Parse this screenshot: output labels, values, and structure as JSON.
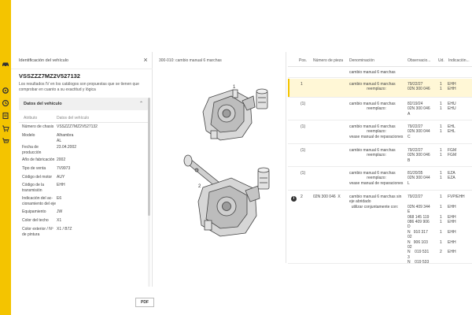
{
  "panel": {
    "title": "Identificación del vehículo",
    "vin": "VSSZZZ7MZ2V527132",
    "description": "Los resultados IV en los catálogos son propuestas que se tienen que comprobar en cuanto a su exactitud y lógica",
    "section_title": "Datos del vehículo",
    "attr_header": "Atributo",
    "value_header": "Datos del vehículo",
    "pdf_label": "PDF",
    "rows": [
      {
        "label": "Número de chasis",
        "value": "VSSZZZ7MZ2V527132"
      },
      {
        "label": "Modelo",
        "value": "Alhambra\nAL"
      },
      {
        "label": "Fecha de\nproducción",
        "value": "23.04.2002"
      },
      {
        "label": "Año de fabricación",
        "value": "2002"
      },
      {
        "label": "Tipo de venta",
        "value": "7V9973"
      },
      {
        "label": "Código del motor",
        "value": "AUY"
      },
      {
        "label": "Código de la\ntransmisión",
        "value": "EHH"
      },
      {
        "label": "Indicación del ac-\ncionamiento del eje",
        "value": "E6"
      },
      {
        "label": "Equipamiento",
        "value": "JW"
      },
      {
        "label": "Color del techo",
        "value": "X1"
      },
      {
        "label": "Color exterior / Nº\nde pintura",
        "value": "X1 / B7Z"
      }
    ]
  },
  "diagram": {
    "title": "300-010: cambio manual 6 marchas"
  },
  "table": {
    "headers": {
      "pos": "Pos.",
      "part_no": "Número de pieza",
      "name": "Denominación",
      "notes": "Observacio...",
      "qty": "Ud.",
      "ind": "Indicación..."
    },
    "rows": [
      {
        "pos": "",
        "part_no": "",
        "name": "cambio manual 6 marchas",
        "notes": "",
        "qty": "",
        "ind": ""
      },
      {
        "pos": "1",
        "part_no": "",
        "name": "cambio manual 6 marchas\n                reemplazo:",
        "notes": "79/22/27\n02N 300 046",
        "qty": "1\n1",
        "ind": "EHH\nEHH"
      },
      {
        "pos": "(1)",
        "part_no": "",
        "name": "cambio manual 6 marchas\n                reemplazo:",
        "notes": "82/19/24\n02N 300 046\nA",
        "qty": "1\n1",
        "ind": "EHU\nEHU"
      },
      {
        "pos": "(1)",
        "part_no": "",
        "name": "cambio manual 6 marchas\n                reemplazo:\nvease manual de reparaciones",
        "notes": "79/22/27\n02N 300 044\nC",
        "qty": "1\n1",
        "ind": "EHL\nEHL"
      },
      {
        "pos": "(1)",
        "part_no": "",
        "name": "cambio manual 6 marchas\n                reemplazo:",
        "notes": "79/22/27\n02N 300 046\nB",
        "qty": "1\n1",
        "ind": "FGM\nFGM"
      },
      {
        "pos": "(1)",
        "part_no": "",
        "name": "cambio manual 6 marchas\n                reemplazo:\nvease manual de reparaciones",
        "notes": "81/20/35\n02N 300 044\nL",
        "qty": "1\n1",
        "ind": "EZA\nEZA"
      },
      {
        "pos": "2",
        "part_no": "02N 300 046  X",
        "name": "cambio manual 6 marchas sin\neje abridado\n  utilizar conjuntamente con:",
        "notes": "79/22/27\n\n02N 409 344\nE\n068 145 119\n086 409 906\nD\nN   910 317\n02\nN   906 103\n02\nN    019 531\n3\nN    019 533",
        "qty": "1\n\n1\n\n1\n1\n\n1\n\n1\n\n2",
        "ind": "FVP/EHH\n\nEHH\n\nEHH\nEHH\n\nEHH\n\nEHH\n\nEHH"
      }
    ]
  }
}
